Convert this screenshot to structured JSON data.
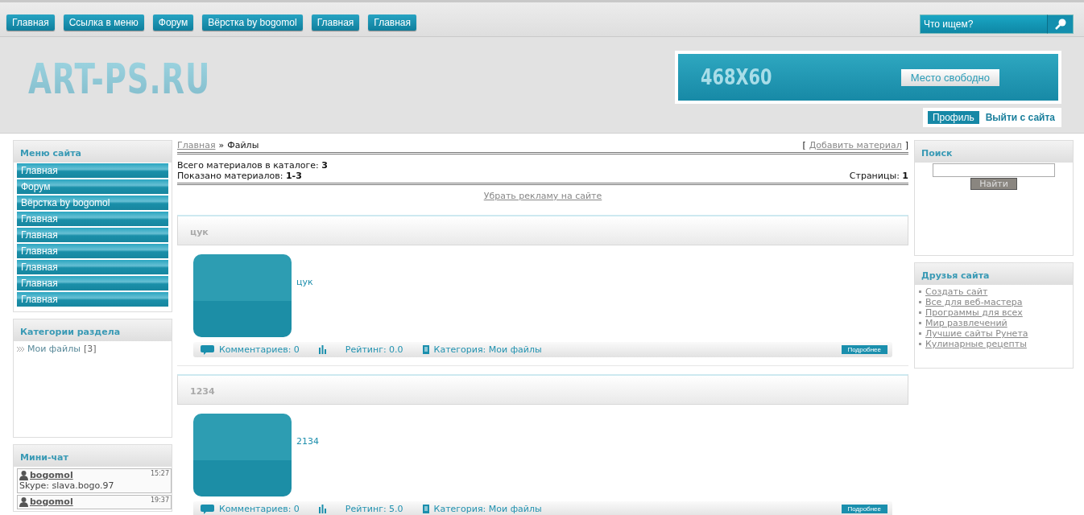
{
  "top_nav": [
    "Главная",
    "Ссылка в меню",
    "Форум",
    "Вёрстка by bogomol",
    "Главная",
    "Главная"
  ],
  "top_search": {
    "placeholder": "Что ищем?"
  },
  "logo": "ART-PS.RU",
  "banner": {
    "size": "468X60",
    "button": "Место свободно"
  },
  "user_bar": {
    "profile": "Профиль",
    "logout": "Выйти с сайта"
  },
  "menu": {
    "title": "Меню сайта",
    "items": [
      "Главная",
      "Форум",
      "Вёрстка by bogomol",
      "Главная",
      "Главная",
      "Главная",
      "Главная",
      "Главная",
      "Главная"
    ]
  },
  "categories": {
    "title": "Категории раздела",
    "items": [
      {
        "name": "Мои файлы",
        "count": "[3]"
      }
    ]
  },
  "chat": {
    "title": "Мини-чат",
    "messages": [
      {
        "user": "bogomol",
        "time": "15:27",
        "text": "Skype: slava.bogo.97"
      },
      {
        "user": "bogomol",
        "time": "19:37"
      }
    ]
  },
  "breadcrumb": {
    "home": "Главная",
    "separator": "»",
    "current": "Файлы",
    "open": "[",
    "add": "Добавить материал",
    "close": "]"
  },
  "stats": {
    "total": "Всего материалов в каталоге: **3**",
    "shown": "Показано материалов: **1-3**",
    "pages": "Страницы: **1**"
  },
  "ad_link": "Убрать рекламу на сайте",
  "posts": [
    {
      "title": "цук",
      "text": "цук",
      "comments": "Комментариев: 0",
      "rating": "Рейтинг: 0.0",
      "category": "Категория: Мои файлы",
      "more": "Подробнее"
    },
    {
      "title": "1234",
      "text": "2134",
      "comments": "Комментариев: 0",
      "rating": "Рейтинг: 5.0",
      "category": "Категория: Мои файлы",
      "more": "Подробнее"
    }
  ],
  "search_block": {
    "title": "Поиск",
    "button": "Найти"
  },
  "friends": {
    "title": "Друзья сайта",
    "links": [
      "Создать сайт",
      "Все для веб-мастера",
      "Программы для всех",
      "Мир развлечений",
      "Лучшие сайты Рунета",
      "Кулинарные рецепты"
    ]
  }
}
